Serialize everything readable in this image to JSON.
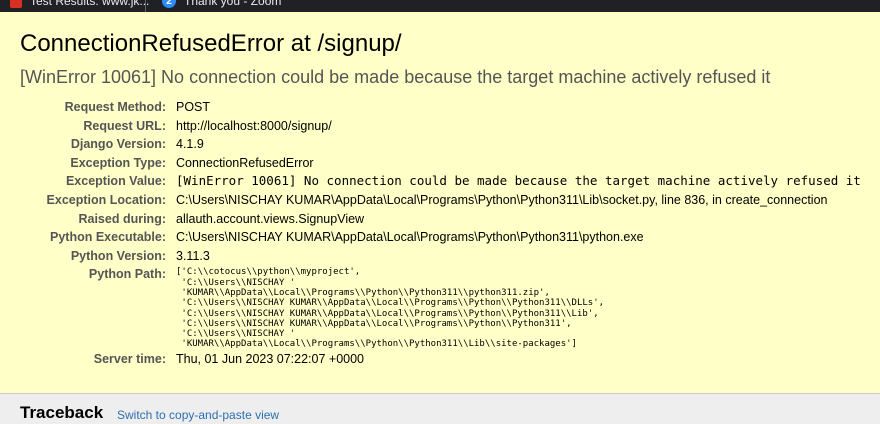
{
  "browser": {
    "tabs": [
      {
        "label": "Test Results: www.jk...",
        "icon": "red-document-icon"
      },
      {
        "label": "Thank you - Zoom",
        "icon": "zoom-icon"
      }
    ]
  },
  "error": {
    "title": "ConnectionRefusedError at /signup/",
    "message": "[WinError 10061] No connection could be made because the target machine actively refused it"
  },
  "meta": {
    "request_method_label": "Request Method:",
    "request_method": "POST",
    "request_url_label": "Request URL:",
    "request_url": "http://localhost:8000/signup/",
    "django_version_label": "Django Version:",
    "django_version": "4.1.9",
    "exception_type_label": "Exception Type:",
    "exception_type": "ConnectionRefusedError",
    "exception_value_label": "Exception Value:",
    "exception_value": "[WinError 10061] No connection could be made because the target machine actively refused it",
    "exception_location_label": "Exception Location:",
    "exception_location": "C:\\Users\\NISCHAY KUMAR\\AppData\\Local\\Programs\\Python\\Python311\\Lib\\socket.py, line 836, in create_connection",
    "raised_during_label": "Raised during:",
    "raised_during": "allauth.account.views.SignupView",
    "python_executable_label": "Python Executable:",
    "python_executable": "C:\\Users\\NISCHAY KUMAR\\AppData\\Local\\Programs\\Python\\Python311\\python.exe",
    "python_version_label": "Python Version:",
    "python_version": "3.11.3",
    "python_path_label": "Python Path:",
    "python_path": "['C:\\\\cotocus\\\\python\\\\myproject',\n 'C:\\\\Users\\\\NISCHAY '\n 'KUMAR\\\\AppData\\\\Local\\\\Programs\\\\Python\\\\Python311\\\\python311.zip',\n 'C:\\\\Users\\\\NISCHAY KUMAR\\\\AppData\\\\Local\\\\Programs\\\\Python\\\\Python311\\\\DLLs',\n 'C:\\\\Users\\\\NISCHAY KUMAR\\\\AppData\\\\Local\\\\Programs\\\\Python\\\\Python311\\\\Lib',\n 'C:\\\\Users\\\\NISCHAY KUMAR\\\\AppData\\\\Local\\\\Programs\\\\Python\\\\Python311',\n 'C:\\\\Users\\\\NISCHAY '\n 'KUMAR\\\\AppData\\\\Local\\\\Programs\\\\Python\\\\Python311\\\\Lib\\\\site-packages']",
    "server_time_label": "Server time:",
    "server_time": "Thu, 01 Jun 2023 07:22:07 +0000"
  },
  "traceback": {
    "title": "Traceback",
    "switch_link": "Switch to copy-and-paste view"
  }
}
